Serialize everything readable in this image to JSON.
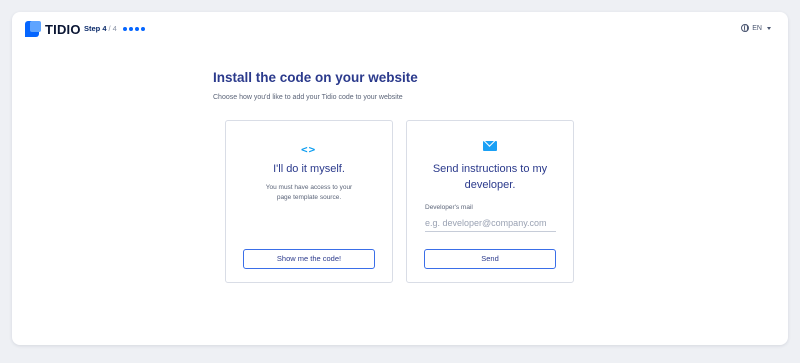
{
  "brand": {
    "name": "TIDIO"
  },
  "step": {
    "label": "Step 4",
    "total": "/ 4",
    "dots": 4
  },
  "language": {
    "icon": "globe-icon",
    "code": "EN"
  },
  "page": {
    "title": "Install the code on your website",
    "subtitle": "Choose how you'd like to add your Tidio code to your website"
  },
  "options": {
    "self": {
      "icon": "code-icon",
      "icon_glyph": "<>",
      "title": "I'll do it myself.",
      "description": "You must have access to your page template source.",
      "button_label": "Show me the code!"
    },
    "developer": {
      "icon": "mail-icon",
      "title": "Send instructions to my developer.",
      "field_label": "Developer's mail",
      "field_value": "",
      "field_placeholder": "e.g. developer@company.com",
      "button_label": "Send"
    }
  },
  "colors": {
    "accent": "#0566ff",
    "heading": "#2b3a8c",
    "icon": "#1aa0f5"
  }
}
